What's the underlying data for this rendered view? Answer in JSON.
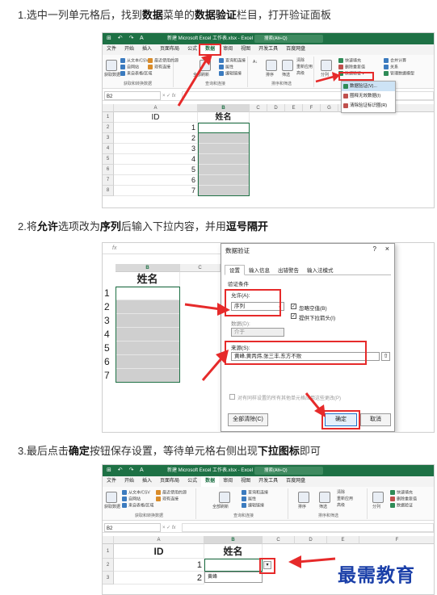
{
  "steps": [
    {
      "prefix": "1.选中一列单元格后，找到",
      "b1": "数据",
      "mid1": "菜单的",
      "b2": "数据验证",
      "suffix": "栏目，打开验证面板"
    },
    {
      "prefix": "2.将",
      "b1": "允许",
      "mid1": "选项改为",
      "b2": "序列",
      "mid2": "后输入下拉内容，并用",
      "b3": "逗号隔开"
    },
    {
      "prefix": "3.最后点击",
      "b1": "确定",
      "mid1": "按钮保存设置，等待单元格右侧出现",
      "b2": "下拉图标",
      "suffix": "即可"
    }
  ],
  "excel": {
    "title": "新建 Microsoft Excel 工作表.xlsx  -  Excel",
    "search": "搜索(Alt+Q)",
    "tabs": [
      "文件",
      "开始",
      "插入",
      "页面布局",
      "公式",
      "数据",
      "审阅",
      "视图",
      "开发工具",
      "百度网盘"
    ],
    "active_tab": "数据",
    "ribbon": {
      "get_data": "获取数据",
      "from_text": "从文本/CSV",
      "from_web": "自网站",
      "from_table": "来自表格/区域",
      "recent_sources": "最近使用的源",
      "existing_conn": "现有连接",
      "group_get": "获取和转换数据",
      "refresh_all": "全部刷新",
      "queries": "查询和连接",
      "properties": "属性",
      "edit_links": "编辑链接",
      "group_query": "查询和连接",
      "sort": "排序",
      "filter": "筛选",
      "clear": "清除",
      "reapply": "重新应用",
      "advanced": "高级",
      "group_sort": "排序和筛选",
      "split": "分列",
      "flash_fill": "快速填充",
      "remove_dup": "删除重复值",
      "data_val": "数据验证",
      "merge_calc": "合并计算",
      "relations": "关系",
      "manage_model": "管理数据模型"
    },
    "name_box": "B2",
    "fx": "fx",
    "col_headers": [
      "A",
      "B",
      "C",
      "D",
      "E",
      "F",
      "G",
      "H"
    ],
    "header_id": "ID",
    "header_name": "姓名",
    "rows": [
      "1",
      "2",
      "3",
      "4",
      "5",
      "6",
      "7"
    ],
    "row_numbers": [
      "1",
      "2",
      "3",
      "4",
      "5",
      "6",
      "7",
      "8"
    ],
    "dv_menu": [
      "数据验证(V)...",
      "圈释无效数据(I)",
      "清除验证标识圈(R)"
    ]
  },
  "dialog": {
    "title": "数据验证",
    "help": "?",
    "close": "×",
    "tabs": [
      "设置",
      "输入信息",
      "出错警告",
      "输入法模式"
    ],
    "criteria": "验证条件",
    "allow_label": "允许(A):",
    "allow_value": "序列",
    "ignore_blank": "忽略空值(B)",
    "in_cell_dropdown": "提供下拉箭头(I)",
    "data_label": "数据(D):",
    "data_value": "介于",
    "source_label": "来源(S):",
    "source_value": "黄峰,黄丙炜,张三丰,东方不败",
    "apply_all": "对有同样设置的所有其他单元格应用这些更改(P)",
    "clear_all": "全部清除(C)",
    "ok": "确定",
    "cancel": "取消"
  },
  "shot3": {
    "dropdown_value": "黄峰"
  },
  "watermark": "最需教育",
  "colors": {
    "excel_green": "#1e7145",
    "highlight_red": "#e62a2a",
    "watermark_blue": "#1a3fa8"
  }
}
